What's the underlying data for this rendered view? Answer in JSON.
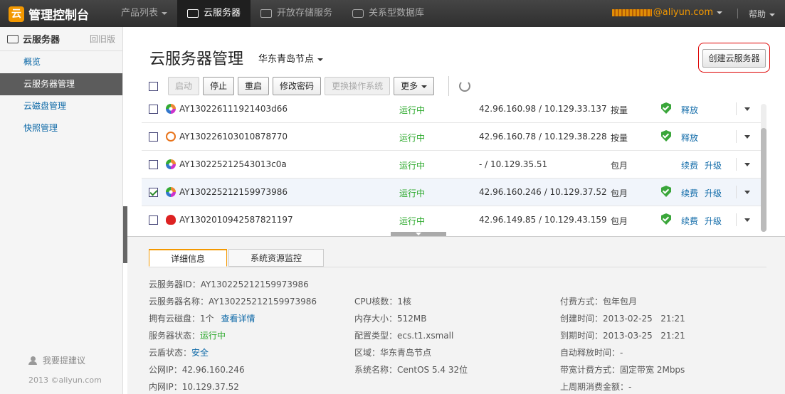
{
  "topbar": {
    "logo_text": "管理控制台",
    "nav": [
      {
        "label": "产品列表"
      },
      {
        "label": "云服务器"
      },
      {
        "label": "开放存储服务"
      },
      {
        "label": "关系型数据库"
      }
    ],
    "user_suffix": "@aliyun.com",
    "help": "帮助"
  },
  "sidebar": {
    "title": "云服务器",
    "old_version": "回旧版",
    "items": [
      {
        "label": "概览"
      },
      {
        "label": "云服务器管理"
      },
      {
        "label": "云磁盘管理"
      },
      {
        "label": "快照管理"
      }
    ],
    "feedback": "我要提建议",
    "copyright": "2013 ©aliyun.com"
  },
  "main": {
    "title": "云服务器管理",
    "region": "华东青岛节点",
    "create_button": "创建云服务器",
    "toolbar": {
      "start": "启动",
      "stop": "停止",
      "restart": "重启",
      "change_password": "修改密码",
      "change_os": "更换操作系统",
      "more": "更多"
    },
    "rows": [
      {
        "id": "AY130226111921403d66",
        "os": "gear",
        "status": "运行中",
        "ip": "42.96.160.98  /  10.129.33.137",
        "pay": "按量",
        "shield": true,
        "link1": "释放",
        "link2": "",
        "checked": false
      },
      {
        "id": "AY130226103010878770",
        "os": "ubuntu",
        "status": "运行中",
        "ip": "42.96.160.78  /  10.129.38.228",
        "pay": "按量",
        "shield": true,
        "link1": "释放",
        "link2": "",
        "checked": false
      },
      {
        "id": "AY130225212543013c0a",
        "os": "gear",
        "status": "运行中",
        "ip": "-  /  10.129.35.51",
        "pay": "包月",
        "shield": false,
        "link1": "续费",
        "link2": "升级",
        "checked": false
      },
      {
        "id": "AY130225212159973986",
        "os": "gear",
        "status": "运行中",
        "ip": "42.96.160.246  /  10.129.37.52",
        "pay": "包月",
        "shield": true,
        "link1": "续费",
        "link2": "升级",
        "checked": true
      },
      {
        "id": "AY1302010942587821197",
        "os": "redhat",
        "status": "运行中",
        "ip": "42.96.149.85  /  10.129.43.159",
        "pay": "包月",
        "shield": true,
        "link1": "续费",
        "link2": "升级",
        "checked": false
      }
    ]
  },
  "details": {
    "tabs": [
      {
        "label": "详细信息"
      },
      {
        "label": "系统资源监控"
      }
    ],
    "col1": [
      {
        "k": "云服务器ID：",
        "v": "AY130225212159973986"
      },
      {
        "k": "云服务器名称：",
        "v": "AY130225212159973986"
      },
      {
        "k": "拥有云磁盘：",
        "v": "1个",
        "link": "查看详情"
      },
      {
        "k": "服务器状态：",
        "v": "运行中"
      },
      {
        "k": "云盾状态：",
        "v": "安全"
      },
      {
        "k": "公网IP：",
        "v": "42.96.160.246"
      },
      {
        "k": "内网IP：",
        "v": "10.129.37.52"
      }
    ],
    "col2": [
      {
        "k": "CPU核数：",
        "v": "1核"
      },
      {
        "k": "内存大小：",
        "v": "512MB"
      },
      {
        "k": "配置类型：",
        "v": "ecs.t1.xsmall"
      },
      {
        "k": "区域：",
        "v": "华东青岛节点"
      },
      {
        "k": "系统名称：",
        "v": "CentOS 5.4 32位"
      }
    ],
    "col3": [
      {
        "k": "付费方式：",
        "v": "包年包月"
      },
      {
        "k": "创建时间：",
        "v": "2013-02-25   21:21"
      },
      {
        "k": "到期时间：",
        "v": "2013-03-25   21:21"
      },
      {
        "k": "自动释放时间：",
        "v": "-"
      },
      {
        "k": "带宽计费方式：",
        "v": "固定带宽 2Mbps"
      },
      {
        "k": "上周期消费金额：",
        "v": "-"
      }
    ]
  }
}
